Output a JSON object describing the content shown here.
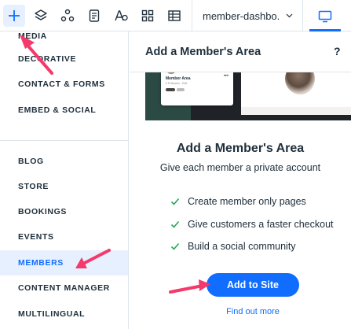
{
  "toolbar": {
    "tools": [
      {
        "icon": "plus-icon",
        "active": true
      },
      {
        "icon": "layers-icon"
      },
      {
        "icon": "apps-icon"
      },
      {
        "icon": "page-icon"
      },
      {
        "icon": "text-theme-icon"
      },
      {
        "icon": "grid-icon"
      },
      {
        "icon": "table-icon"
      }
    ],
    "page_selector": "member-dashbo.",
    "device": "desktop-icon"
  },
  "categories": {
    "items": [
      {
        "label": "MEDIA"
      },
      {
        "label": "DECORATIVE"
      },
      {
        "label": "CONTACT & FORMS"
      },
      {
        "label": "EMBED & SOCIAL"
      },
      {
        "label": "BLOG"
      },
      {
        "label": "STORE"
      },
      {
        "label": "BOOKINGS"
      },
      {
        "label": "EVENTS"
      },
      {
        "label": "MEMBERS",
        "selected": true
      },
      {
        "label": "CONTENT MANAGER"
      },
      {
        "label": "MULTILINGUAL"
      }
    ]
  },
  "panel": {
    "header_title": "Add a Member's Area",
    "help_label": "?",
    "preview": {
      "card_name": "Member Area",
      "card_meta": "0 Followers · Edit"
    },
    "title": "Add a Member's Area",
    "subtitle": "Give each member a private account",
    "features": [
      "Create member only pages",
      "Give customers a faster checkout",
      "Build a social community"
    ],
    "add_button": "Add to Site",
    "find_link": "Find out more"
  },
  "colors": {
    "accent": "#116dff",
    "selected_bg": "#e7f0ff",
    "check": "#26a65b",
    "annotation": "#f5396b"
  }
}
